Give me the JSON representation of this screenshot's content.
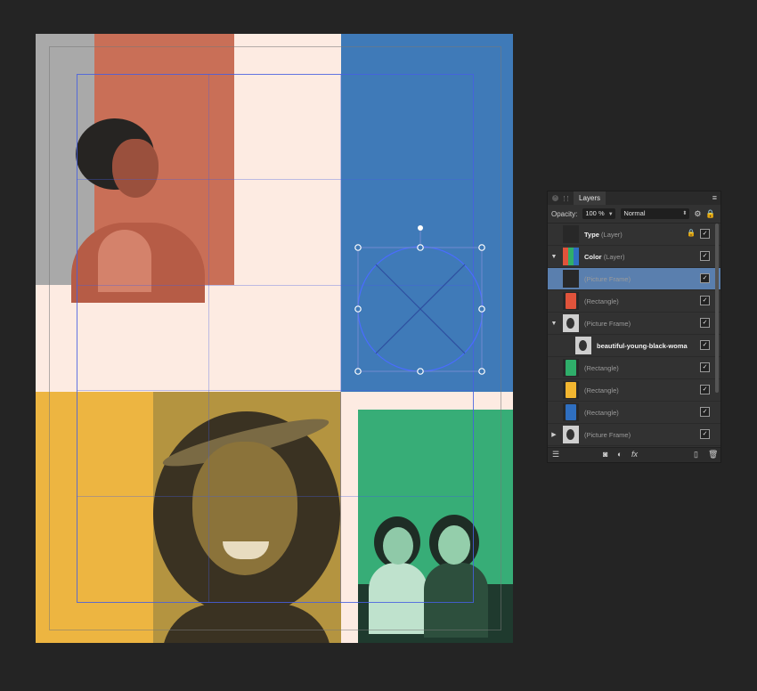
{
  "layers_panel": {
    "tab_label": "Layers",
    "opacity_label": "Opacity:",
    "opacity_value": "100 %",
    "blend_mode": "Normal",
    "layers": [
      {
        "name": "Type",
        "kind": "(Layer)",
        "bold": true,
        "indent": 0,
        "expander": "",
        "swatch": "",
        "locked": true,
        "visible": true,
        "selected": false
      },
      {
        "name": "Color",
        "kind": "(Layer)",
        "bold": true,
        "indent": 0,
        "expander": "▼",
        "swatch": "multi",
        "locked": false,
        "visible": true,
        "selected": false
      },
      {
        "name": "",
        "kind": "(Picture Frame)",
        "bold": false,
        "indent": 1,
        "expander": "",
        "swatch": "",
        "locked": false,
        "visible": true,
        "selected": true
      },
      {
        "name": "",
        "kind": "(Rectangle)",
        "bold": false,
        "indent": 1,
        "expander": "",
        "swatch": "#e0533b",
        "locked": false,
        "visible": true,
        "selected": false
      },
      {
        "name": "",
        "kind": "(Picture Frame)",
        "bold": false,
        "indent": 1,
        "expander": "▼",
        "swatch": "photo",
        "locked": false,
        "visible": true,
        "selected": false
      },
      {
        "name": "beautiful-young-black-woma",
        "kind": "",
        "bold": true,
        "indent": 2,
        "expander": "",
        "swatch": "photo",
        "locked": false,
        "visible": true,
        "selected": false
      },
      {
        "name": "",
        "kind": "(Rectangle)",
        "bold": false,
        "indent": 1,
        "expander": "",
        "swatch": "#2fae6a",
        "locked": false,
        "visible": true,
        "selected": false
      },
      {
        "name": "",
        "kind": "(Rectangle)",
        "bold": false,
        "indent": 1,
        "expander": "",
        "swatch": "#f2b630",
        "locked": false,
        "visible": true,
        "selected": false
      },
      {
        "name": "",
        "kind": "(Rectangle)",
        "bold": false,
        "indent": 1,
        "expander": "",
        "swatch": "#2f6fc0",
        "locked": false,
        "visible": true,
        "selected": false
      },
      {
        "name": "",
        "kind": "(Picture Frame)",
        "bold": false,
        "indent": 1,
        "expander": "▶",
        "swatch": "photo",
        "locked": false,
        "visible": true,
        "selected": false
      }
    ],
    "check_glyph": "✓",
    "lock_glyph": "🔒"
  },
  "colors": {
    "red_block": "#c96f57",
    "blue_block": "#3f7ab8",
    "yellow_block": "#edb541",
    "green_block": "#37ad77",
    "paper": "#fdebe2",
    "selection": "#4a6cff"
  }
}
